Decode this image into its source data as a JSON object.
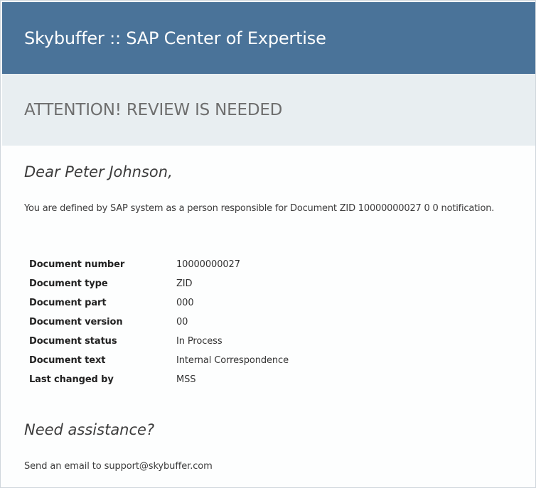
{
  "header": {
    "title": "Skybuffer :: SAP Center of Expertise"
  },
  "banner": {
    "title": "ATTENTION! REVIEW IS NEEDED"
  },
  "message": {
    "greeting": "Dear Peter Johnson,",
    "intro": "You are defined by SAP system as a person responsible for Document ZID 10000000027 0 0 notification."
  },
  "details": {
    "rows": [
      {
        "label": "Document number",
        "value": "10000000027"
      },
      {
        "label": "Document type",
        "value": "ZID"
      },
      {
        "label": "Document part",
        "value": "000"
      },
      {
        "label": "Document version",
        "value": "00"
      },
      {
        "label": "Document status",
        "value": "In Process"
      },
      {
        "label": "Document text",
        "value": "Internal Correspondence"
      },
      {
        "label": "Last changed by",
        "value": "MSS"
      }
    ]
  },
  "assistance": {
    "title": "Need assistance?",
    "text": "Send an email to support@skybuffer.com"
  },
  "colors": {
    "header_bg": "#4a7399",
    "banner_bg": "#e8eef1"
  }
}
